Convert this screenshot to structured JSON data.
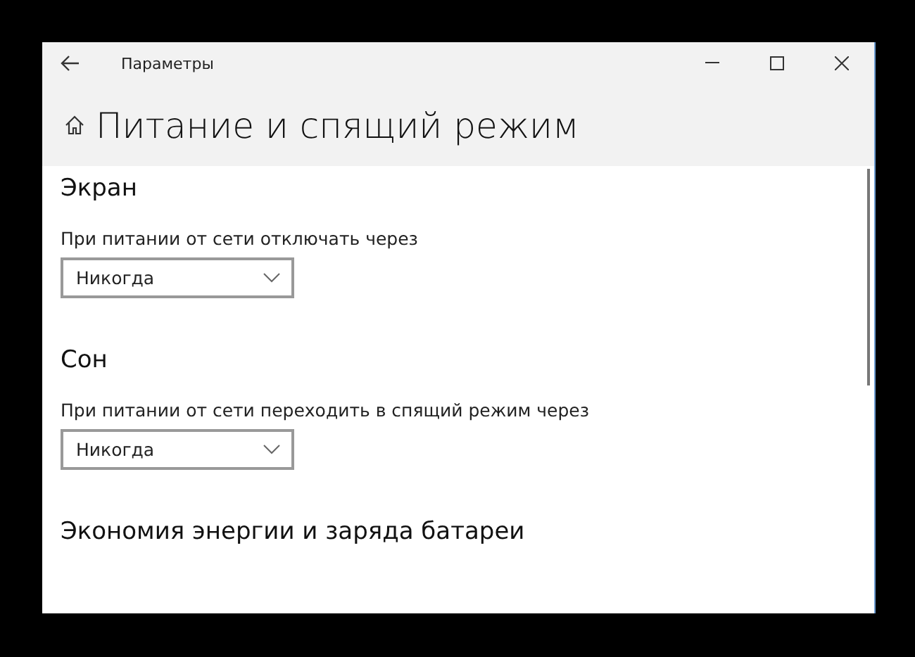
{
  "window": {
    "title": "Параметры"
  },
  "page": {
    "title": "Питание и спящий режим"
  },
  "sections": [
    {
      "heading": "Экран",
      "label": "При питании от сети отключать через",
      "dropdown": {
        "value": "Никогда"
      }
    },
    {
      "heading": "Сон",
      "label": "При питании от сети переходить в спящий режим через",
      "dropdown": {
        "value": "Никогда"
      }
    },
    {
      "heading": "Экономия энергии и заряда батареи"
    }
  ]
}
